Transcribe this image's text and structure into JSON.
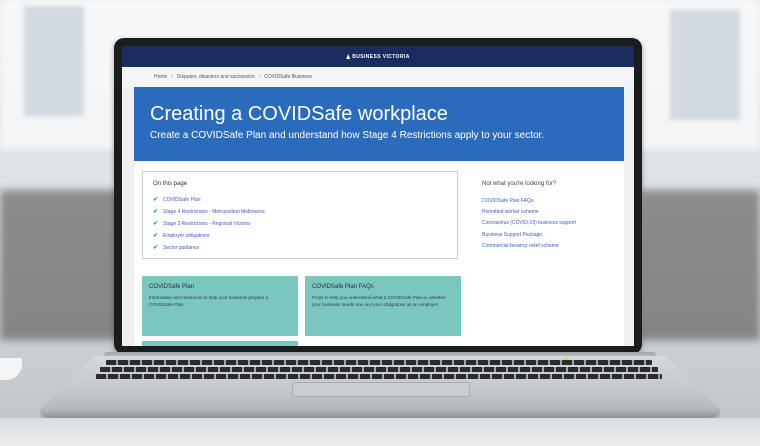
{
  "site": {
    "logo": "BUSINESS VICTORIA"
  },
  "breadcrumb": [
    {
      "label": "Home"
    },
    {
      "label": "Disputes, disasters and succession"
    },
    {
      "label": "COVIDSafe Business"
    }
  ],
  "hero": {
    "title": "Creating a COVIDSafe workplace",
    "subtitle": "Create a COVIDSafe Plan and understand how Stage 4 Restrictions apply to your sector."
  },
  "toc": {
    "heading": "On this page",
    "items": [
      {
        "label": "COVIDSafe Plan"
      },
      {
        "label": "Stage 4 Restrictions - Metropolitan Melbourne"
      },
      {
        "label": "Stage 3 Restrictions - Regional Victoria"
      },
      {
        "label": "Employer obligations"
      },
      {
        "label": "Sector guidance"
      }
    ]
  },
  "related": {
    "heading": "Not what you're looking for?",
    "links": [
      {
        "label": "COVIDSafe Plan FAQs"
      },
      {
        "label": "Permitted worker scheme"
      },
      {
        "label": "Coronavirus (COVID-19) business support"
      },
      {
        "label": "Business Support Package"
      },
      {
        "label": "Commercial tenancy relief scheme"
      }
    ]
  },
  "cards": [
    {
      "title": "COVIDSafe Plan",
      "text": "Information and resources to help your business prepare a COVIDSafe Plan."
    },
    {
      "title": "COVIDSafe Plan FAQs",
      "text": "FAQs to help you understand what a COVIDSafe Plan is, whether your business needs one and your obligations as an employer."
    }
  ],
  "colors": {
    "header": "#1a2b5f",
    "hero": "#2a6bbb",
    "card": "#7cc6c0",
    "link": "#3b5bbd",
    "check": "#2e9e4f"
  }
}
